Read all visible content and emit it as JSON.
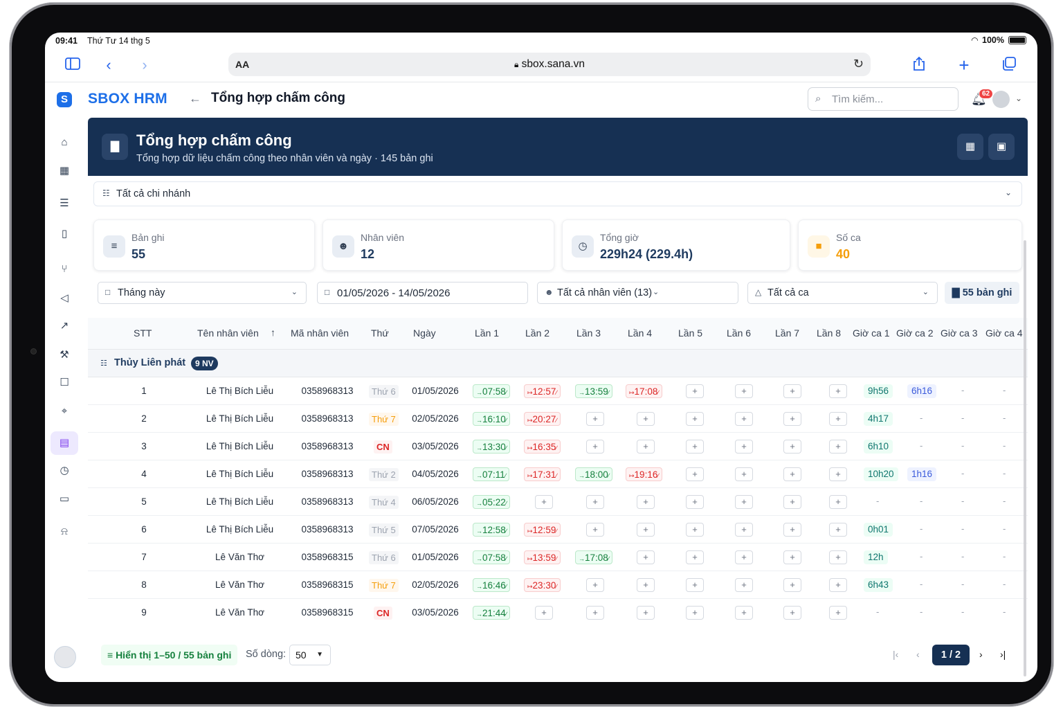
{
  "status_bar": {
    "time": "09:41",
    "date": "Thứ Tư 14 thg 5",
    "battery": "100%"
  },
  "browser": {
    "aa": "AA",
    "url": "sbox.sana.vn"
  },
  "app": {
    "brand": "SBOX HRM",
    "page_title": "Tổng hợp chấm công",
    "search_placeholder": "Tìm kiếm...",
    "notification_count": "62"
  },
  "hero": {
    "title": "Tổng hợp chấm công",
    "subtitle": "Tổng hợp dữ liệu chấm công theo nhân viên và ngày · 145 bản ghi"
  },
  "branch_filter": "Tất cả chi nhánh",
  "stats": [
    {
      "label": "Bản ghi",
      "value": "55",
      "icon": "list-icon"
    },
    {
      "label": "Nhân viên",
      "value": "12",
      "icon": "users-icon"
    },
    {
      "label": "Tổng giờ",
      "value": "229h24 (229.4h)",
      "icon": "clock-icon"
    },
    {
      "label": "Số ca",
      "value": "40",
      "icon": "briefcase-icon"
    }
  ],
  "filters": {
    "period": "Tháng này",
    "date_range": "01/05/2026 - 14/05/2026",
    "employees": "Tất cả nhân viên (13)",
    "shifts": "Tất cả ca",
    "records": "55 bản ghi"
  },
  "table": {
    "headers": [
      "STT",
      "Tên nhân viên",
      "Mã nhân viên",
      "Thứ",
      "Ngày",
      "Lần 1",
      "Lần 2",
      "Lần 3",
      "Lần 4",
      "Lần 5",
      "Lần 6",
      "Lần 7",
      "Lần 8",
      "Giờ ca 1",
      "Giờ ca 2",
      "Giờ ca 3",
      "Giờ ca 4"
    ],
    "group": {
      "name": "Thủy Liên phát",
      "badge": "9 NV"
    },
    "rows": [
      {
        "stt": "1",
        "name": "Lê Thị Bích Liễu",
        "code": "0358968313",
        "day": "Thứ 6",
        "day_type": "n",
        "date": "01/05/2026",
        "punches": [
          "07:58",
          "12:57",
          "13:59",
          "17:08"
        ],
        "h1": "9h56",
        "h2": "6h16"
      },
      {
        "stt": "2",
        "name": "Lê Thị Bích Liễu",
        "code": "0358968313",
        "day": "Thứ 7",
        "day_type": "s",
        "date": "02/05/2026",
        "punches": [
          "16:10",
          "20:27"
        ],
        "h1": "4h17",
        "h2": "-"
      },
      {
        "stt": "3",
        "name": "Lê Thị Bích Liễu",
        "code": "0358968313",
        "day": "CN",
        "day_type": "c",
        "date": "03/05/2026",
        "punches": [
          "13:30",
          "16:35"
        ],
        "h1": "6h10",
        "h2": "-"
      },
      {
        "stt": "4",
        "name": "Lê Thị Bích Liễu",
        "code": "0358968313",
        "day": "Thứ 2",
        "day_type": "n",
        "date": "04/05/2026",
        "punches": [
          "07:11",
          "17:31",
          "18:00",
          "19:16"
        ],
        "h1": "10h20",
        "h2": "1h16"
      },
      {
        "stt": "5",
        "name": "Lê Thị Bích Liễu",
        "code": "0358968313",
        "day": "Thứ 4",
        "day_type": "n",
        "date": "06/05/2026",
        "punches": [
          "05:22"
        ],
        "h1": "-",
        "h2": "-"
      },
      {
        "stt": "6",
        "name": "Lê Thị Bích Liễu",
        "code": "0358968313",
        "day": "Thứ 5",
        "day_type": "n",
        "date": "07/05/2026",
        "punches": [
          "12:58",
          "12:59"
        ],
        "h1": "0h01",
        "h2": "-"
      },
      {
        "stt": "7",
        "name": "Lê Văn Thơ",
        "code": "0358968315",
        "day": "Thứ 6",
        "day_type": "n",
        "date": "01/05/2026",
        "punches": [
          "07:58",
          "13:59",
          "17:08"
        ],
        "h1": "12h",
        "h2": "-"
      },
      {
        "stt": "8",
        "name": "Lê Văn Thơ",
        "code": "0358968315",
        "day": "Thứ 7",
        "day_type": "s",
        "date": "02/05/2026",
        "punches": [
          "16:46",
          "23:30"
        ],
        "h1": "6h43",
        "h2": "-"
      },
      {
        "stt": "9",
        "name": "Lê Văn Thơ",
        "code": "0358968315",
        "day": "CN",
        "day_type": "c",
        "date": "03/05/2026",
        "punches": [
          "21:44"
        ],
        "h1": "-",
        "h2": "-"
      }
    ]
  },
  "footer": {
    "showing": "Hiển thị 1–50 / 55 bản ghi",
    "rows_label": "Số dòng:",
    "rows_value": "50",
    "page": "1 / 2"
  },
  "colors": {
    "brand": "#1d6fe8",
    "hero": "#163053",
    "in": "#15803d",
    "out": "#dc2626"
  }
}
